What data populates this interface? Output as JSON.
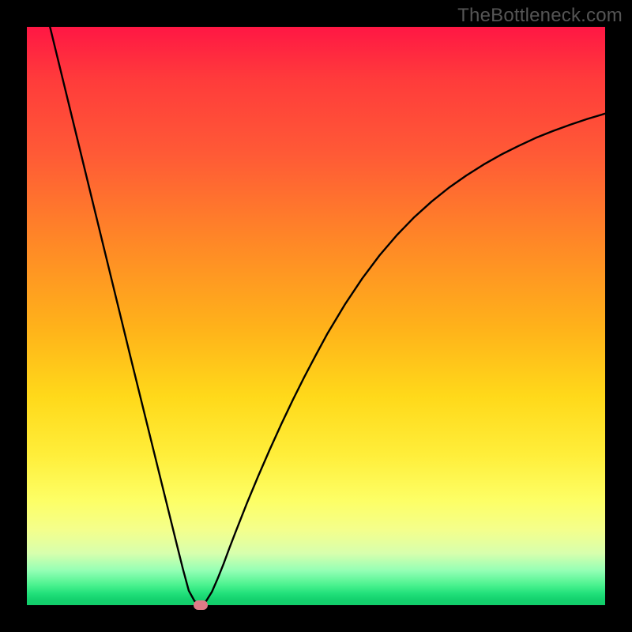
{
  "attribution": "TheBottleneck.com",
  "chart_data": {
    "type": "line",
    "title": "",
    "xlabel": "",
    "ylabel": "",
    "xlim": [
      0,
      100
    ],
    "ylim": [
      0,
      100
    ],
    "x": [
      4,
      6,
      8,
      10,
      12,
      14,
      16,
      18,
      20,
      22,
      24,
      26,
      27,
      28,
      29,
      30,
      31,
      32,
      33,
      34,
      35,
      36,
      38,
      40,
      42,
      44,
      46,
      48,
      50,
      52,
      55,
      58,
      61,
      64,
      67,
      70,
      73,
      76,
      79,
      82,
      85,
      88,
      91,
      94,
      97,
      100
    ],
    "values": [
      100,
      91.8,
      83.6,
      75.4,
      67.2,
      59.0,
      50.8,
      42.6,
      34.5,
      26.4,
      18.3,
      10.2,
      6.2,
      2.5,
      0.7,
      0.1,
      0.7,
      2.3,
      4.6,
      7.1,
      9.8,
      12.4,
      17.5,
      22.3,
      26.9,
      31.3,
      35.5,
      39.5,
      43.3,
      47.0,
      52.0,
      56.5,
      60.5,
      64.0,
      67.1,
      69.8,
      72.2,
      74.3,
      76.2,
      77.9,
      79.4,
      80.8,
      82.0,
      83.1,
      84.1,
      85.0
    ],
    "optimum_x": 30,
    "marker": {
      "x": 30,
      "y": 0
    },
    "background_gradient": {
      "top_color": "#ff1744",
      "middle_color": "#ffd91a",
      "bottom_color": "#12cc6a"
    }
  }
}
